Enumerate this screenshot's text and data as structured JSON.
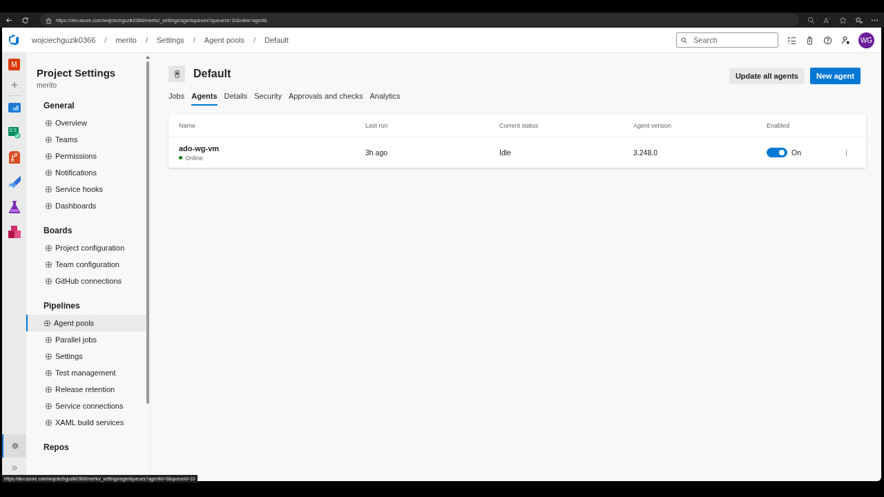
{
  "browser": {
    "url": "https://dev.azure.com/wojciechguzik0366/merito/_settings/agentqueues?queueId=10&view=agents",
    "status_url": "https://dev.azure.com/wojciechguzik0366/merito/_settings/agentqueues?agentId=9&queueId=10"
  },
  "header": {
    "breadcrumbs": [
      "wojciechguzik0366",
      "merito",
      "Settings",
      "Agent pools",
      "Default"
    ],
    "breadcrumb_separators": [
      "/",
      "/",
      "/",
      "/"
    ],
    "search": {
      "placeholder": "Search"
    },
    "avatar": "WG"
  },
  "rail": {
    "project_initial": "M"
  },
  "sidebar": {
    "title": "Project Settings",
    "subtitle": "merito",
    "sections": [
      {
        "heading": "General",
        "items": [
          {
            "label": "Overview",
            "selected": false
          },
          {
            "label": "Teams",
            "selected": false
          },
          {
            "label": "Permissions",
            "selected": false
          },
          {
            "label": "Notifications",
            "selected": false
          },
          {
            "label": "Service hooks",
            "selected": false
          },
          {
            "label": "Dashboards",
            "selected": false
          }
        ]
      },
      {
        "heading": "Boards",
        "items": [
          {
            "label": "Project configuration",
            "selected": false
          },
          {
            "label": "Team configuration",
            "selected": false
          },
          {
            "label": "GitHub connections",
            "selected": false
          }
        ]
      },
      {
        "heading": "Pipelines",
        "items": [
          {
            "label": "Agent pools",
            "selected": true
          },
          {
            "label": "Parallel jobs",
            "selected": false
          },
          {
            "label": "Settings",
            "selected": false
          },
          {
            "label": "Test management",
            "selected": false
          },
          {
            "label": "Release retention",
            "selected": false
          },
          {
            "label": "Service connections",
            "selected": false
          },
          {
            "label": "XAML build services",
            "selected": false
          }
        ]
      },
      {
        "heading": "Repos"
      }
    ]
  },
  "page": {
    "title": "Default",
    "buttons": [
      {
        "label": "Update all agents",
        "kind": "secondary"
      },
      {
        "label": "New agent",
        "kind": "primary"
      }
    ],
    "tabs": [
      {
        "label": "Jobs",
        "selected": false
      },
      {
        "label": "Agents",
        "selected": true
      },
      {
        "label": "Details",
        "selected": false
      },
      {
        "label": "Security",
        "selected": false
      },
      {
        "label": "Approvals and checks",
        "selected": false
      },
      {
        "label": "Analytics",
        "selected": false
      }
    ],
    "table": {
      "columns": [
        "Name",
        "Last run",
        "Current status",
        "Agent version",
        "Enabled"
      ],
      "rows": [
        {
          "name": "ado-wg-vm",
          "status": "Online",
          "color": "#107c10",
          "last_run": "3h ago",
          "current_status": "Idle",
          "agent_version": "3.248.0",
          "enabled": true,
          "enabled_label": "On"
        }
      ]
    }
  }
}
